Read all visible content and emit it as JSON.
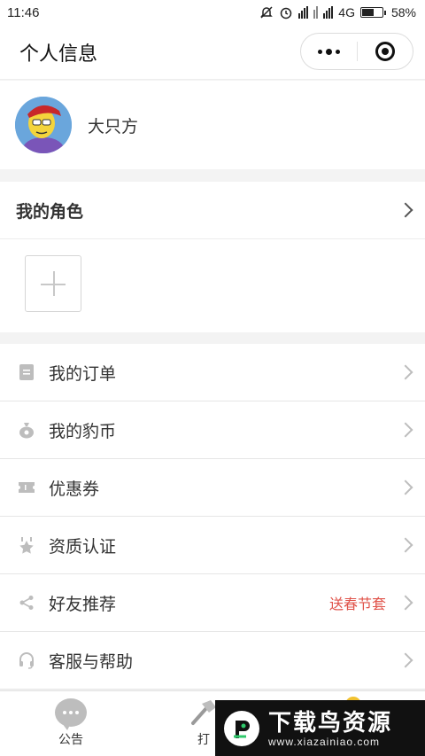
{
  "status_bar": {
    "time": "11:46",
    "network": "4G",
    "battery": "58%",
    "battery_level": 0.58
  },
  "nav": {
    "title": "个人信息",
    "more_icon": "more-dots-icon",
    "close_icon": "target-close-icon"
  },
  "profile": {
    "username": "大只方",
    "avatar_icon": "cartoon-avatar"
  },
  "roles": {
    "title": "我的角色",
    "add_icon": "plus-icon"
  },
  "menu": [
    {
      "label": "我的订单",
      "icon": "order-icon",
      "extra": ""
    },
    {
      "label": "我的豹币",
      "icon": "coin-bag-icon",
      "extra": ""
    },
    {
      "label": "优惠券",
      "icon": "coupon-icon",
      "extra": ""
    },
    {
      "label": "资质认证",
      "icon": "badge-icon",
      "extra": ""
    },
    {
      "label": "好友推荐",
      "icon": "share-icon",
      "extra": "送春节套"
    },
    {
      "label": "客服与帮助",
      "icon": "headset-icon",
      "extra": ""
    }
  ],
  "tabs": [
    {
      "label": "公告",
      "icon": "chat-bubble-icon"
    },
    {
      "label": "打",
      "icon": "hammer-icon"
    }
  ],
  "watermark": {
    "title": "下载鸟资源",
    "url": "www.xiazainiao.com"
  },
  "colors": {
    "accent_red": "#e0534a",
    "icon_gray": "#bdbdbd"
  }
}
